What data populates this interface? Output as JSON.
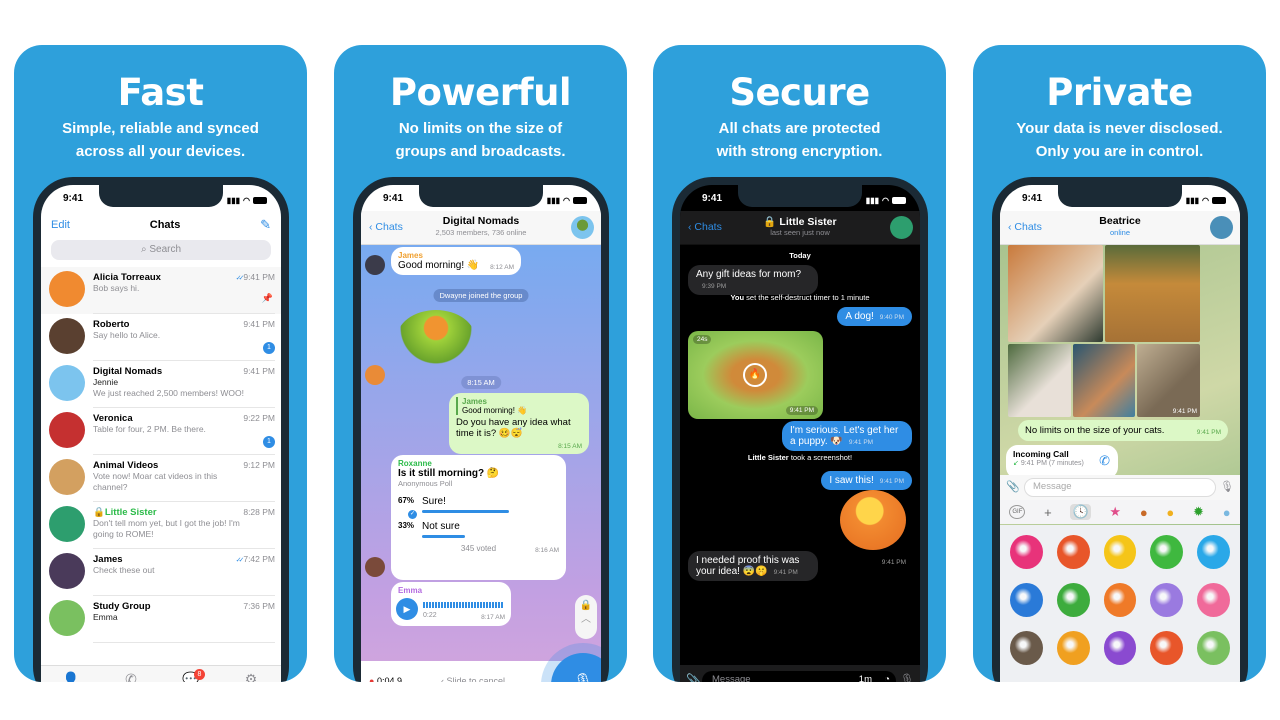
{
  "status_time": "9:41",
  "panels": [
    {
      "title": "Fast",
      "subtitle_line1": "Simple, reliable and synced",
      "subtitle_line2": "across all your devices."
    },
    {
      "title": "Powerful",
      "subtitle_line1": "No limits on the size of",
      "subtitle_line2": "groups and broadcasts."
    },
    {
      "title": "Secure",
      "subtitle_line1": "All chats are protected",
      "subtitle_line2": "with strong encryption."
    },
    {
      "title": "Private",
      "subtitle_line1": "Your data is never disclosed.",
      "subtitle_line2": "Only you are in control."
    }
  ],
  "chats_screen": {
    "edit": "Edit",
    "title": "Chats",
    "search_placeholder": "Search",
    "rows": [
      {
        "name": "Alicia Torreaux",
        "text": "Bob says hi.",
        "time": "9:41 PM",
        "read": true,
        "pinned": true
      },
      {
        "name": "Roberto",
        "text": "Say hello to Alice.",
        "time": "9:41 PM",
        "unread": "1"
      },
      {
        "name": "Digital Nomads",
        "sender": "Jennie",
        "text": "We just reached 2,500 members! WOO!",
        "time": "9:41 PM"
      },
      {
        "name": "Veronica",
        "text": "Table for four, 2 PM. Be there.",
        "time": "9:22 PM",
        "unread": "1"
      },
      {
        "name": "Animal Videos",
        "text": "Vote now! Moar cat videos in this channel?",
        "time": "9:12 PM"
      },
      {
        "name": "Little Sister",
        "text": "Don't tell mom yet, but I got the job! I'm going to ROME!",
        "time": "8:28 PM",
        "secret": true
      },
      {
        "name": "James",
        "text": "Check these out",
        "time": "7:42 PM",
        "read": true
      },
      {
        "name": "Study Group",
        "sender": "Emma",
        "text": "",
        "time": "7:36 PM"
      }
    ],
    "tabs": [
      {
        "label": "Contacts",
        "icon": "contacts-icon"
      },
      {
        "label": "Calls",
        "icon": "phone-icon"
      },
      {
        "label": "Chats",
        "icon": "chats-icon",
        "badge": "8",
        "active": true
      },
      {
        "label": "Settings",
        "icon": "gear-icon"
      }
    ]
  },
  "group_screen": {
    "back": "Chats",
    "title": "Digital Nomads",
    "subtitle": "2,503 members, 736 online",
    "msg1": {
      "sender": "James",
      "text": "Good morning! 👋",
      "time": "8:12 AM"
    },
    "system": "Dwayne joined the group",
    "sticker_time": "8:15 AM",
    "reply": {
      "quote_sender": "James",
      "quote_text": "Good morning! 👋",
      "text": "Do you have any idea what time it is? 🥴😴",
      "time": "8:15 AM"
    },
    "poll": {
      "sender": "Roxanne",
      "question": "Is it still morning? 🤔",
      "type": "Anonymous Poll",
      "options": [
        {
          "pct": "67%",
          "label": "Sure!",
          "value": 67,
          "chosen": true
        },
        {
          "pct": "33%",
          "label": "Not sure",
          "value": 33
        }
      ],
      "votes": "345 voted",
      "time": "8:16 AM"
    },
    "voice": {
      "sender": "Emma",
      "duration": "0:22",
      "time": "8:17 AM"
    },
    "recording": {
      "timer": "0:04,9",
      "cancel": "Slide to cancel"
    }
  },
  "secret_screen": {
    "back": "Chats",
    "title": "Little Sister",
    "subtitle": "last seen just now",
    "date": "Today",
    "messages": [
      {
        "dir": "in",
        "text": "Any gift ideas for mom?",
        "time": "9:39 PM"
      },
      {
        "dir": "sys",
        "bold": "You",
        "text": "set the self-destruct timer to 1 minute"
      },
      {
        "dir": "out",
        "text": "A dog!",
        "time": "9:40 PM"
      },
      {
        "dir": "photo",
        "timer": "24s",
        "time": "9:41 PM"
      },
      {
        "dir": "out",
        "text": "I'm serious. Let's get her a puppy. 🐶",
        "time": "9:41 PM"
      },
      {
        "dir": "sys",
        "bold": "Little Sister",
        "text": "took a screenshot!"
      },
      {
        "dir": "out",
        "text": "I saw this!",
        "time": "9:41 PM"
      },
      {
        "dir": "sticker",
        "time": "9:41 PM"
      },
      {
        "dir": "in",
        "text": "I needed proof this was your idea! 😨🤫",
        "time": "9:41 PM"
      }
    ],
    "input_placeholder": "Message",
    "timer_label": "1m"
  },
  "private_screen": {
    "back": "Chats",
    "title": "Beatrice",
    "subtitle": "online",
    "album_time": "9:41 PM",
    "message": {
      "text": "No limits on the size of your cats.",
      "time": "9:41 PM"
    },
    "call": {
      "title": "Incoming Call",
      "detail": "9:41 PM (7 minutes)"
    },
    "input_placeholder": "Message",
    "sticker_tabs": [
      "GIF",
      "+",
      "recent"
    ]
  },
  "colors": {
    "brand": "#2ea0db",
    "accent": "#2f8de4",
    "secret": "#2dbb4a"
  }
}
